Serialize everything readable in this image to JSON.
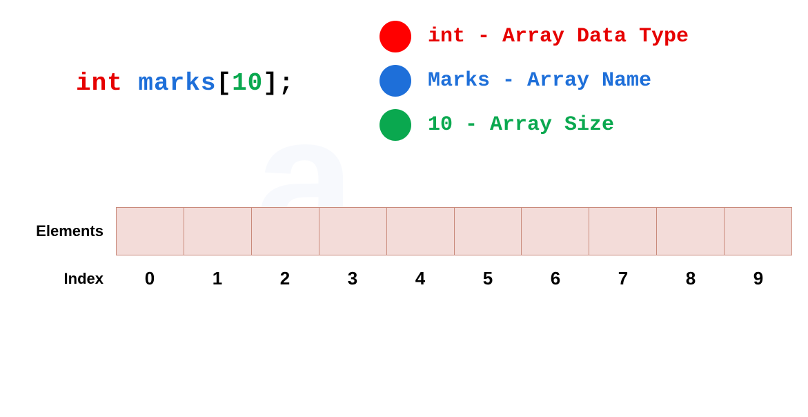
{
  "declaration": {
    "type": "int",
    "name": "marks",
    "open_bracket": "[",
    "size": "10",
    "close_bracket": "]",
    "semicolon": ";"
  },
  "legend": {
    "items": [
      {
        "label": "int - Array Data Type",
        "color": "#ff0000"
      },
      {
        "label": "Marks - Array Name",
        "color": "#1e6fd9"
      },
      {
        "label": "10 - Array Size",
        "color": "#0aa84f"
      }
    ]
  },
  "array": {
    "elements_label": "Elements",
    "index_label": "Index",
    "size": 10,
    "indices": [
      "0",
      "1",
      "2",
      "3",
      "4",
      "5",
      "6",
      "7",
      "8",
      "9"
    ]
  },
  "watermark": "a"
}
